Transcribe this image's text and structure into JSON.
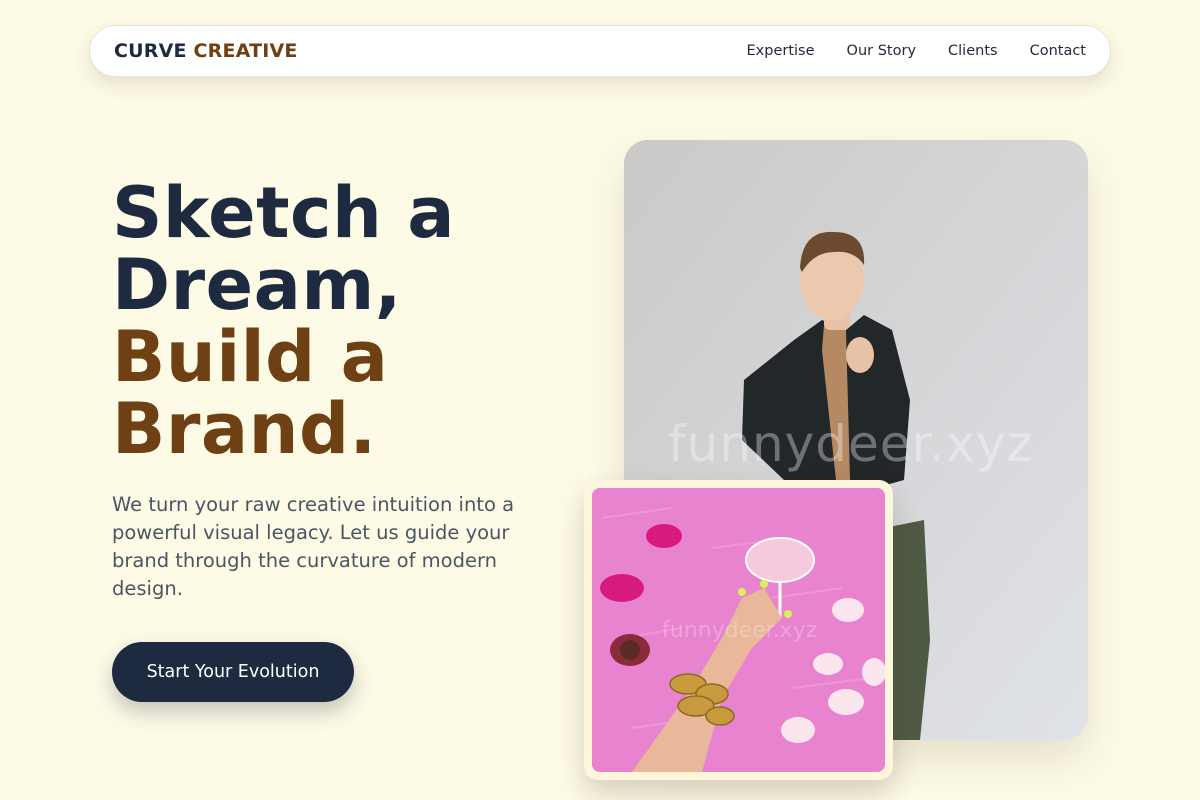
{
  "brand": {
    "part1": "CURVE",
    "part2": "CREATIVE"
  },
  "nav": {
    "items": [
      "Expertise",
      "Our Story",
      "Clients",
      "Contact"
    ]
  },
  "hero": {
    "line1": "Sketch a",
    "line2": "Dream,",
    "line3": "Build a",
    "line4": "Brand.",
    "subtitle": "We turn your raw creative intuition into a powerful visual legacy. Let us guide your brand through the curvature of modern design.",
    "cta_label": "Start Your Evolution"
  },
  "images": {
    "main_watermark": "funnydeer.xyz",
    "small_watermark": "funnydeer.xyz"
  },
  "colors": {
    "background": "#fdfae6",
    "navy": "#1d2a40",
    "brown": "#6e4013",
    "body_text": "#4b5563"
  }
}
